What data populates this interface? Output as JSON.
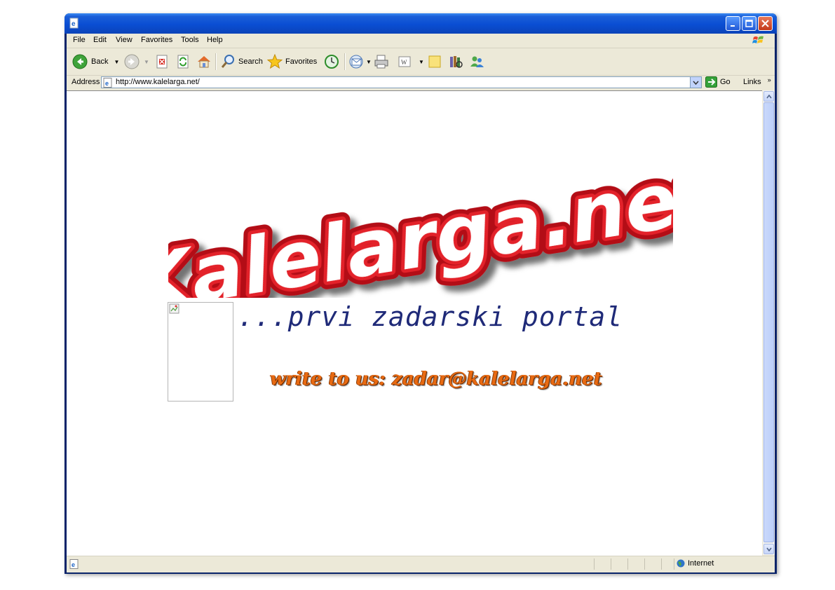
{
  "window": {
    "title": ""
  },
  "menu": {
    "items": [
      "File",
      "Edit",
      "View",
      "Favorites",
      "Tools",
      "Help"
    ]
  },
  "toolbar": {
    "back_label": "Back",
    "search_label": "Search",
    "favorites_label": "Favorites"
  },
  "address": {
    "label": "Address",
    "url": "http://www.kalelarga.net/",
    "go_label": "Go",
    "links_label": "Links"
  },
  "page": {
    "logo_text": "Kalelarga.net",
    "tagline": "...prvi zadarski portal",
    "contact": "write to us: zadar@kalelarga.net"
  },
  "status": {
    "zone": "Internet"
  },
  "colors": {
    "logo_red": "#d8141e",
    "tagline_navy": "#1f2a78",
    "contact_orange": "#e86a12"
  }
}
